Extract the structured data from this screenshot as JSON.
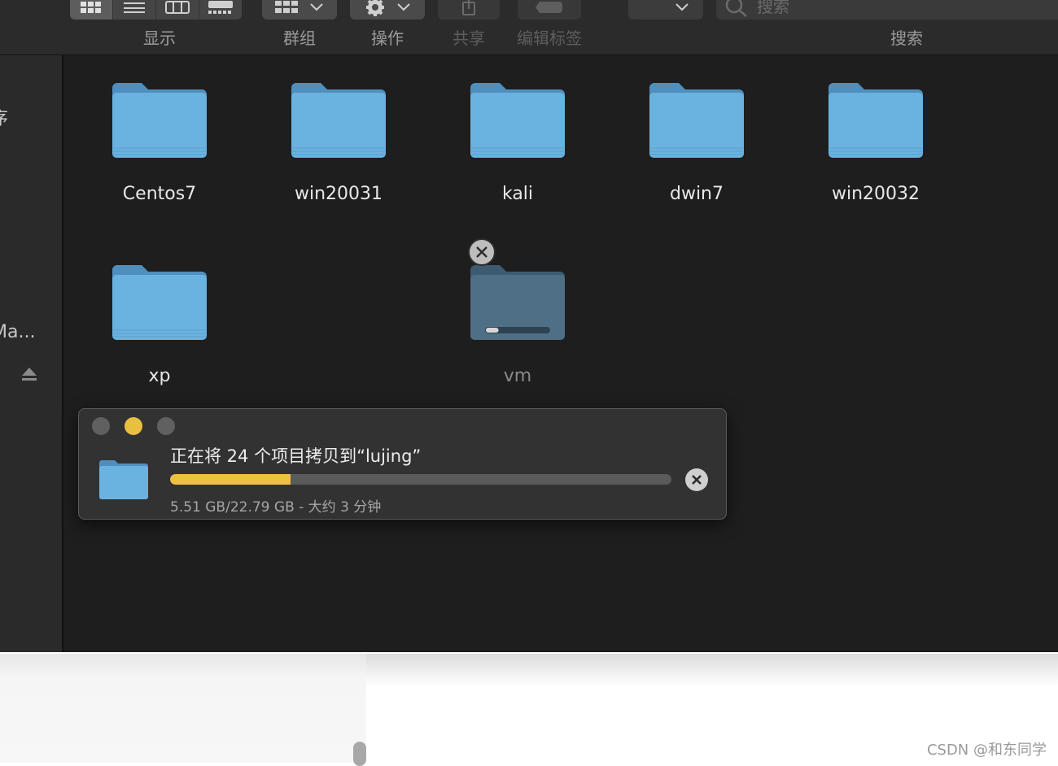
{
  "toolbar": {
    "view_label": "显示",
    "group_label": "群组",
    "action_label": "操作",
    "share_label": "共享",
    "tags_label": "编辑标签",
    "search_label": "搜索",
    "search_placeholder": "搜索"
  },
  "sidebar": {
    "partial_top": "序",
    "partial_device": "Ma..."
  },
  "folders": [
    {
      "name": "Centos7"
    },
    {
      "name": "win20031"
    },
    {
      "name": "kali"
    },
    {
      "name": "dwin7"
    },
    {
      "name": "win20032"
    },
    {
      "name": "xp"
    },
    {
      "name": "vm",
      "copy_progress": 0.2
    }
  ],
  "copy_dialog": {
    "title": "正在将 24 个项目拷贝到“lujing”",
    "status": "5.51 GB/22.79 GB - 大约 3 分钟",
    "progress": 0.24
  },
  "colors": {
    "folder_blue": "#6ab3e0",
    "progress_yellow": "#f0c040",
    "minimize_yellow": "#e8c040"
  },
  "watermark": "CSDN @和东同学"
}
